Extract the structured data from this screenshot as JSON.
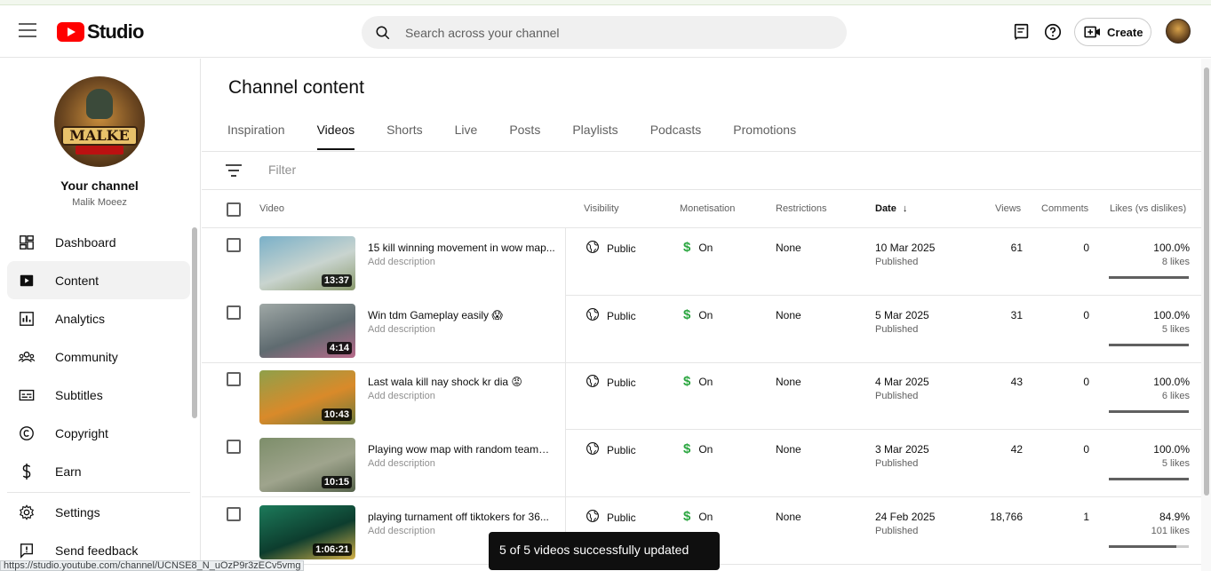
{
  "header": {
    "brand": "Studio",
    "search_placeholder": "Search across your channel",
    "create_label": "Create"
  },
  "sidebar": {
    "your_channel": "Your channel",
    "channel_name": "Malik Moeez",
    "avatar_text": "MALKE",
    "items": [
      {
        "label": "Dashboard",
        "icon": "dashboard-icon"
      },
      {
        "label": "Content",
        "icon": "content-icon"
      },
      {
        "label": "Analytics",
        "icon": "analytics-icon"
      },
      {
        "label": "Community",
        "icon": "community-icon"
      },
      {
        "label": "Subtitles",
        "icon": "subtitles-icon"
      },
      {
        "label": "Copyright",
        "icon": "copyright-icon"
      },
      {
        "label": "Earn",
        "icon": "earn-icon"
      }
    ],
    "bottom_items": [
      {
        "label": "Settings",
        "icon": "gear-icon"
      },
      {
        "label": "Send feedback",
        "icon": "feedback-icon"
      }
    ]
  },
  "main": {
    "title": "Channel content",
    "tabs": [
      "Inspiration",
      "Videos",
      "Shorts",
      "Live",
      "Posts",
      "Playlists",
      "Podcasts",
      "Promotions"
    ],
    "active_tab": "Videos",
    "filter_placeholder": "Filter",
    "columns": {
      "video": "Video",
      "visibility": "Visibility",
      "monetisation": "Monetisation",
      "restrictions": "Restrictions",
      "date": "Date",
      "views": "Views",
      "comments": "Comments",
      "likes": "Likes (vs dislikes)"
    },
    "rows": [
      {
        "title": "15 kill winning movement in wow map...",
        "description": "Add description",
        "duration": "13:37",
        "visibility": "Public",
        "monetisation": "On",
        "restrictions": "None",
        "date": "10 Mar 2025",
        "status": "Published",
        "views": "61",
        "comments": "0",
        "likes_pct": "100.0%",
        "likes_count": "8 likes",
        "like_ratio": 1.0,
        "thumb": [
          "#7ab0c8",
          "#c9d4cf",
          "#8a9a6e"
        ]
      },
      {
        "title": "Win tdm Gameplay easily 😱",
        "description": "Add description",
        "duration": "4:14",
        "visibility": "Public",
        "monetisation": "On",
        "restrictions": "None",
        "date": "5 Mar 2025",
        "status": "Published",
        "views": "31",
        "comments": "0",
        "likes_pct": "100.0%",
        "likes_count": "5 likes",
        "like_ratio": 1.0,
        "thumb": [
          "#9fa8a6",
          "#5f6b70",
          "#b86a8a"
        ]
      },
      {
        "title": "Last wala kill nay shock kr dia 😡",
        "description": "Add description",
        "duration": "10:43",
        "visibility": "Public",
        "monetisation": "On",
        "restrictions": "None",
        "date": "4 Mar 2025",
        "status": "Published",
        "views": "43",
        "comments": "0",
        "likes_pct": "100.0%",
        "likes_count": "6 likes",
        "like_ratio": 1.0,
        "thumb": [
          "#8fa04a",
          "#d98a2a",
          "#6d7a3a"
        ]
      },
      {
        "title": "Playing wow map with random teamm...",
        "description": "Add description",
        "duration": "10:15",
        "visibility": "Public",
        "monetisation": "On",
        "restrictions": "None",
        "date": "3 Mar 2025",
        "status": "Published",
        "views": "42",
        "comments": "0",
        "likes_pct": "100.0%",
        "likes_count": "5 likes",
        "like_ratio": 1.0,
        "thumb": [
          "#7d8e6a",
          "#9fa48d",
          "#55624a"
        ]
      },
      {
        "title": "playing turnament off tiktokers for 36...",
        "description": "Add description",
        "duration": "1:06:21",
        "visibility": "Public",
        "monetisation": "On",
        "restrictions": "None",
        "date": "24 Feb 2025",
        "status": "Published",
        "views": "18,766",
        "comments": "1",
        "likes_pct": "84.9%",
        "likes_count": "101 likes",
        "like_ratio": 0.849,
        "thumb": [
          "#1c7a5a",
          "#0d3d2e",
          "#d2b048"
        ]
      }
    ]
  },
  "toast": "5 of 5 videos successfully updated",
  "status_url": "https://studio.youtube.com/channel/UCNSE8_N_uOzP9r3zECv5vmg"
}
